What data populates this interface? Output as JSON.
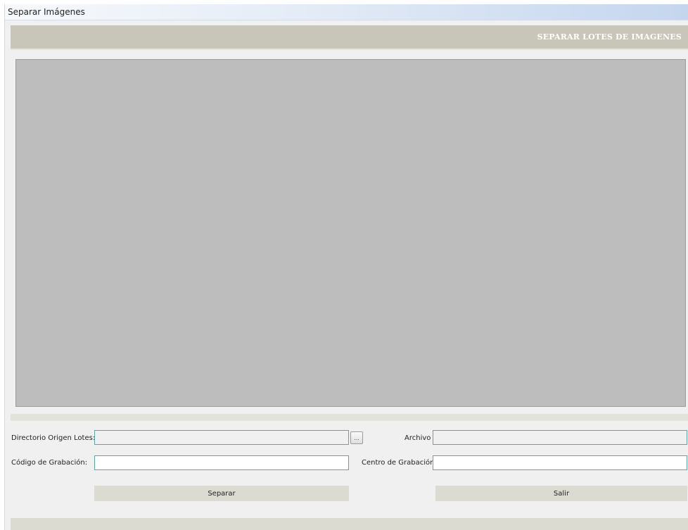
{
  "window": {
    "title": "Separar Imágenes"
  },
  "header": {
    "title": "SEPARAR LOTES DE IMAGENES"
  },
  "form": {
    "dir_label": "Directorio Origen Lotes:",
    "dir_value": "",
    "browse_label": "...",
    "archivo_label": "Archivo",
    "archivo_value": "",
    "codigo_label": "Código de Grabación:",
    "codigo_value": "",
    "centro_label": "Centro de Grabación",
    "centro_value": ""
  },
  "actions": {
    "separar_label": "Separar",
    "salir_label": "Salir"
  },
  "colors": {
    "header_band": "#c8c6b8",
    "preview_bg": "#bdbdbd",
    "field_border": "#58a8a8",
    "button_bg": "#dcdbd2"
  }
}
